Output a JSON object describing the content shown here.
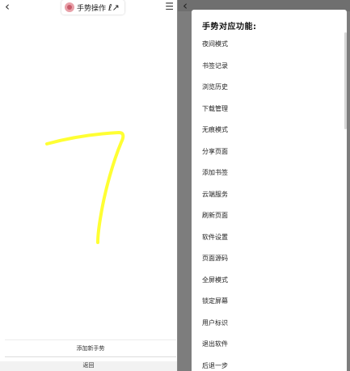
{
  "left_panel": {
    "back_glyph": "‹",
    "title": "手势操作",
    "title_gesture": "ℓ↗",
    "menu_glyph": "☰",
    "stroke_color": "#ffff33",
    "add_gesture_label": "添加新手势",
    "return_label": "返回"
  },
  "right_panel": {
    "back_glyph": "‹",
    "dialog_title": "手势对应功能:",
    "options": [
      "夜间模式",
      "书签记录",
      "浏览历史",
      "下载管理",
      "无痕模式",
      "分享页面",
      "添加书签",
      "云端服务",
      "刷新页面",
      "软件设置",
      "页面源码",
      "全屏模式",
      "锁定屏幕",
      "用户标识",
      "退出软件",
      "后退一步"
    ]
  }
}
